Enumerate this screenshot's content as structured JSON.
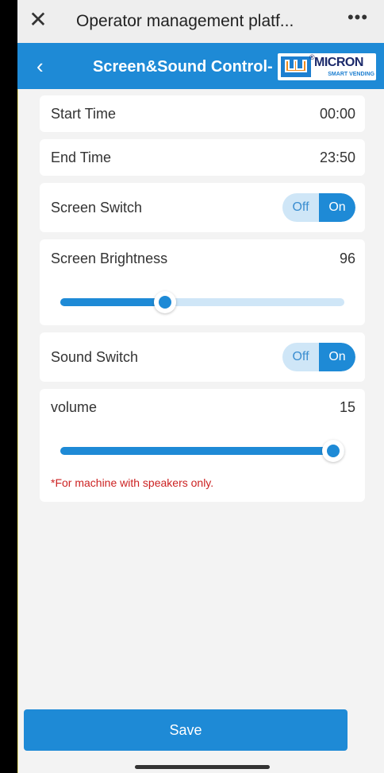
{
  "topbar": {
    "close_icon": "close-icon",
    "title": "Operator management platf...",
    "more_icon": "more-icon"
  },
  "header": {
    "back_icon": "chevron-left-icon",
    "title": "Screen&Sound Control-",
    "logo": {
      "brand": "MICRON",
      "tagline": "SMART VENDING"
    }
  },
  "settings": {
    "start_time": {
      "label": "Start Time",
      "value": "00:00"
    },
    "end_time": {
      "label": "End Time",
      "value": "23:50"
    },
    "screen_switch": {
      "label": "Screen Switch",
      "off_label": "Off",
      "on_label": "On",
      "state": "On"
    },
    "screen_brightness": {
      "label": "Screen Brightness",
      "value": "96",
      "level": 0.37
    },
    "sound_switch": {
      "label": "Sound Switch",
      "off_label": "Off",
      "on_label": "On",
      "state": "On"
    },
    "volume": {
      "label": "volume",
      "value": "15",
      "level": 1.0,
      "note": "*For machine with speakers only."
    }
  },
  "footer": {
    "save_label": "Save"
  },
  "colors": {
    "accent": "#1e8ad6",
    "track": "#cfe6f7",
    "note": "#cc2222"
  }
}
